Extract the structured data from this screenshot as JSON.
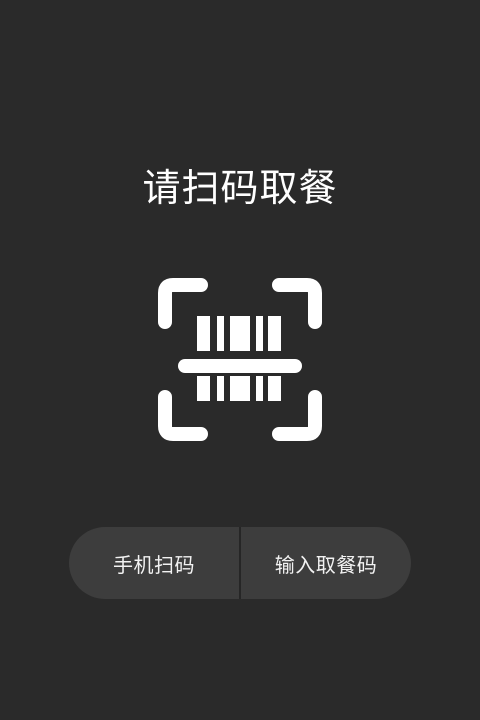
{
  "page": {
    "title": "请扫码取餐",
    "background_color": "#2a2a2a"
  },
  "scan_icon": {
    "name": "barcode-scan-icon",
    "color": "#ffffff"
  },
  "actions": {
    "phone_scan_label": "手机扫码",
    "enter_code_label": "输入取餐码"
  }
}
